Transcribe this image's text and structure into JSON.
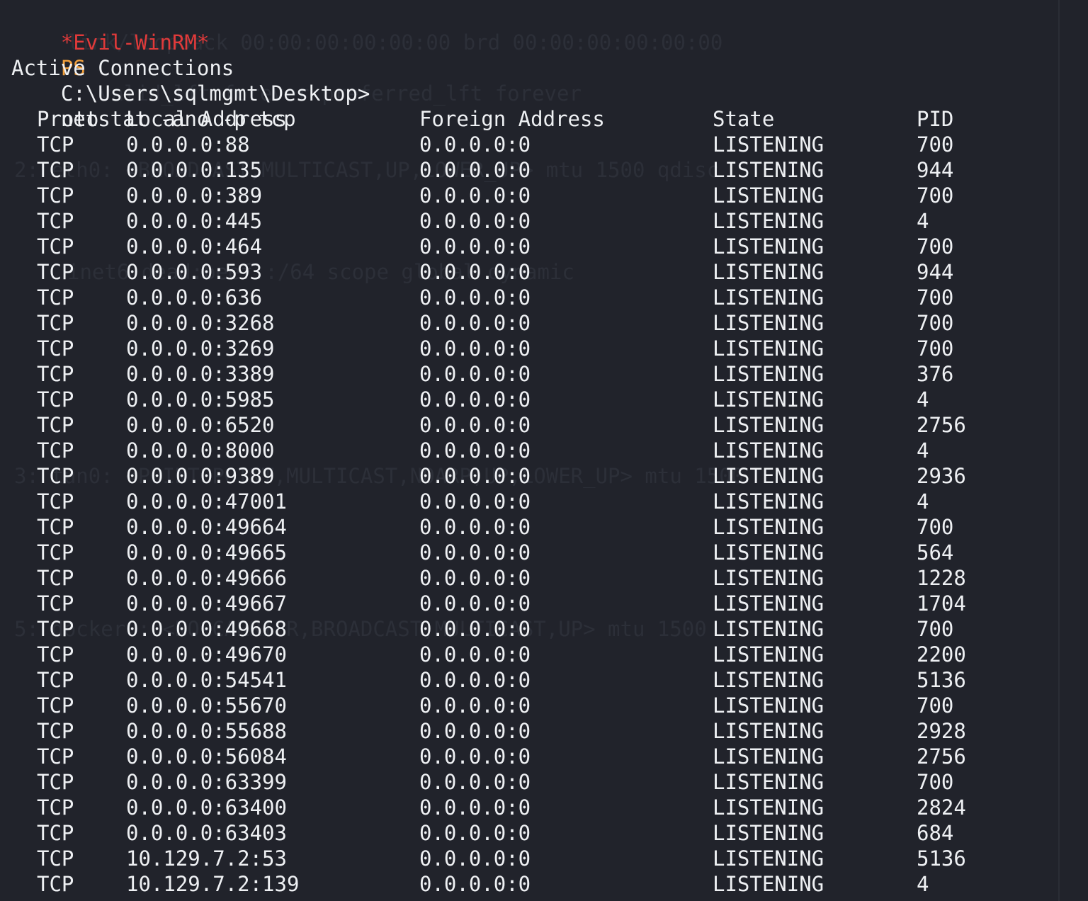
{
  "prompt": {
    "shell_name": "*Evil-WinRM*",
    "ps": "PS",
    "path": "C:\\Users\\sqlmgmt\\Desktop>",
    "command": "netstat -ano -p tcp"
  },
  "section_title": "Active Connections",
  "headers": {
    "proto": "Proto",
    "local": "Local Address",
    "foreign": "Foreign Address",
    "state": "State",
    "pid": "PID"
  },
  "connections": [
    {
      "proto": "TCP",
      "local": "0.0.0.0:88",
      "foreign": "0.0.0.0:0",
      "state": "LISTENING",
      "pid": "700"
    },
    {
      "proto": "TCP",
      "local": "0.0.0.0:135",
      "foreign": "0.0.0.0:0",
      "state": "LISTENING",
      "pid": "944"
    },
    {
      "proto": "TCP",
      "local": "0.0.0.0:389",
      "foreign": "0.0.0.0:0",
      "state": "LISTENING",
      "pid": "700"
    },
    {
      "proto": "TCP",
      "local": "0.0.0.0:445",
      "foreign": "0.0.0.0:0",
      "state": "LISTENING",
      "pid": "4"
    },
    {
      "proto": "TCP",
      "local": "0.0.0.0:464",
      "foreign": "0.0.0.0:0",
      "state": "LISTENING",
      "pid": "700"
    },
    {
      "proto": "TCP",
      "local": "0.0.0.0:593",
      "foreign": "0.0.0.0:0",
      "state": "LISTENING",
      "pid": "944"
    },
    {
      "proto": "TCP",
      "local": "0.0.0.0:636",
      "foreign": "0.0.0.0:0",
      "state": "LISTENING",
      "pid": "700"
    },
    {
      "proto": "TCP",
      "local": "0.0.0.0:3268",
      "foreign": "0.0.0.0:0",
      "state": "LISTENING",
      "pid": "700"
    },
    {
      "proto": "TCP",
      "local": "0.0.0.0:3269",
      "foreign": "0.0.0.0:0",
      "state": "LISTENING",
      "pid": "700"
    },
    {
      "proto": "TCP",
      "local": "0.0.0.0:3389",
      "foreign": "0.0.0.0:0",
      "state": "LISTENING",
      "pid": "376"
    },
    {
      "proto": "TCP",
      "local": "0.0.0.0:5985",
      "foreign": "0.0.0.0:0",
      "state": "LISTENING",
      "pid": "4"
    },
    {
      "proto": "TCP",
      "local": "0.0.0.0:6520",
      "foreign": "0.0.0.0:0",
      "state": "LISTENING",
      "pid": "2756"
    },
    {
      "proto": "TCP",
      "local": "0.0.0.0:8000",
      "foreign": "0.0.0.0:0",
      "state": "LISTENING",
      "pid": "4"
    },
    {
      "proto": "TCP",
      "local": "0.0.0.0:9389",
      "foreign": "0.0.0.0:0",
      "state": "LISTENING",
      "pid": "2936"
    },
    {
      "proto": "TCP",
      "local": "0.0.0.0:47001",
      "foreign": "0.0.0.0:0",
      "state": "LISTENING",
      "pid": "4"
    },
    {
      "proto": "TCP",
      "local": "0.0.0.0:49664",
      "foreign": "0.0.0.0:0",
      "state": "LISTENING",
      "pid": "700"
    },
    {
      "proto": "TCP",
      "local": "0.0.0.0:49665",
      "foreign": "0.0.0.0:0",
      "state": "LISTENING",
      "pid": "564"
    },
    {
      "proto": "TCP",
      "local": "0.0.0.0:49666",
      "foreign": "0.0.0.0:0",
      "state": "LISTENING",
      "pid": "1228"
    },
    {
      "proto": "TCP",
      "local": "0.0.0.0:49667",
      "foreign": "0.0.0.0:0",
      "state": "LISTENING",
      "pid": "1704"
    },
    {
      "proto": "TCP",
      "local": "0.0.0.0:49668",
      "foreign": "0.0.0.0:0",
      "state": "LISTENING",
      "pid": "700"
    },
    {
      "proto": "TCP",
      "local": "0.0.0.0:49670",
      "foreign": "0.0.0.0:0",
      "state": "LISTENING",
      "pid": "2200"
    },
    {
      "proto": "TCP",
      "local": "0.0.0.0:54541",
      "foreign": "0.0.0.0:0",
      "state": "LISTENING",
      "pid": "5136"
    },
    {
      "proto": "TCP",
      "local": "0.0.0.0:55670",
      "foreign": "0.0.0.0:0",
      "state": "LISTENING",
      "pid": "700"
    },
    {
      "proto": "TCP",
      "local": "0.0.0.0:55688",
      "foreign": "0.0.0.0:0",
      "state": "LISTENING",
      "pid": "2928"
    },
    {
      "proto": "TCP",
      "local": "0.0.0.0:56084",
      "foreign": "0.0.0.0:0",
      "state": "LISTENING",
      "pid": "2756"
    },
    {
      "proto": "TCP",
      "local": "0.0.0.0:63399",
      "foreign": "0.0.0.0:0",
      "state": "LISTENING",
      "pid": "700"
    },
    {
      "proto": "TCP",
      "local": "0.0.0.0:63400",
      "foreign": "0.0.0.0:0",
      "state": "LISTENING",
      "pid": "2824"
    },
    {
      "proto": "TCP",
      "local": "0.0.0.0:63403",
      "foreign": "0.0.0.0:0",
      "state": "LISTENING",
      "pid": "684"
    },
    {
      "proto": "TCP",
      "local": "10.129.7.2:53",
      "foreign": "0.0.0.0:0",
      "state": "LISTENING",
      "pid": "5136"
    },
    {
      "proto": "TCP",
      "local": "10.129.7.2:139",
      "foreign": "0.0.0.0:0",
      "state": "LISTENING",
      "pid": "4"
    }
  ]
}
